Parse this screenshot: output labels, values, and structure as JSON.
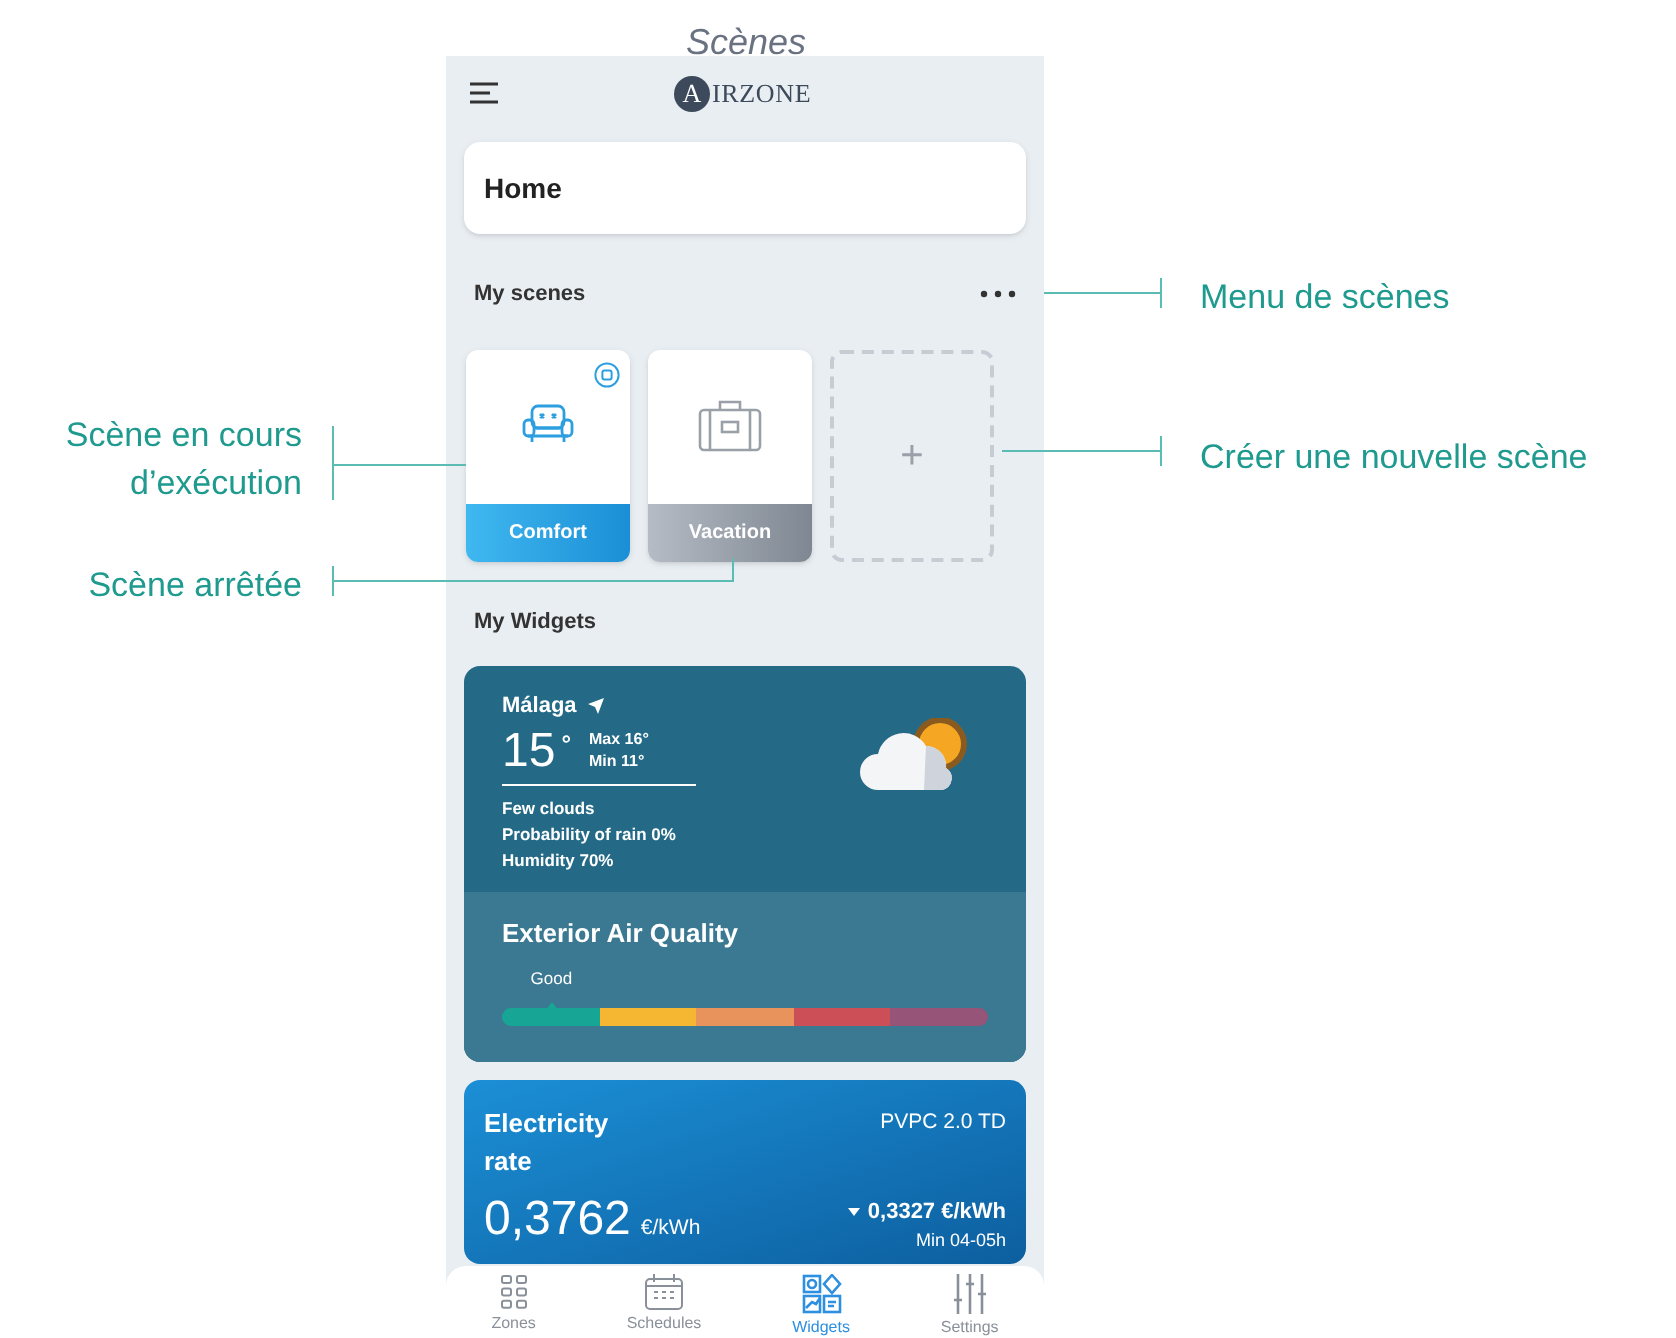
{
  "caption": "Scènes",
  "app": {
    "logo": "IRZONE",
    "logo_initial": "A",
    "home": "Home",
    "scenes_title": "My scenes",
    "scenes": [
      {
        "kind": "scene",
        "label": "Comfort",
        "running": true
      },
      {
        "kind": "scene",
        "label": "Vacation",
        "running": false
      },
      {
        "kind": "add",
        "label": "+"
      }
    ],
    "widgets_title": "My Widgets",
    "weather": {
      "city": "Málaga",
      "temp": "15",
      "degree": "°",
      "max": "Max 16°",
      "min": "Min 11°",
      "lines": [
        "Few clouds",
        "Probability of rain 0%",
        "Humidity 70%"
      ]
    },
    "air_quality": {
      "title": "Exterior Air Quality",
      "rating": "Good",
      "level": 0.1
    },
    "electricity": {
      "title": "Electricity rate",
      "tariff": "PVPC 2.0 TD",
      "price": "0,3762",
      "unit": "€/kWh",
      "min_price": "0,3327 €/kWh",
      "min_time": "Min 04-05h"
    },
    "nav": [
      {
        "label": "Zones",
        "selected": false
      },
      {
        "label": "Schedules",
        "selected": false
      },
      {
        "label": "Widgets",
        "selected": true
      },
      {
        "label": "Settings",
        "selected": false
      }
    ]
  },
  "annotations": [
    "Menu de scènes",
    "Scène en cours d’exécution",
    "Créer une nouvelle scène",
    "Scène arrêtée"
  ]
}
